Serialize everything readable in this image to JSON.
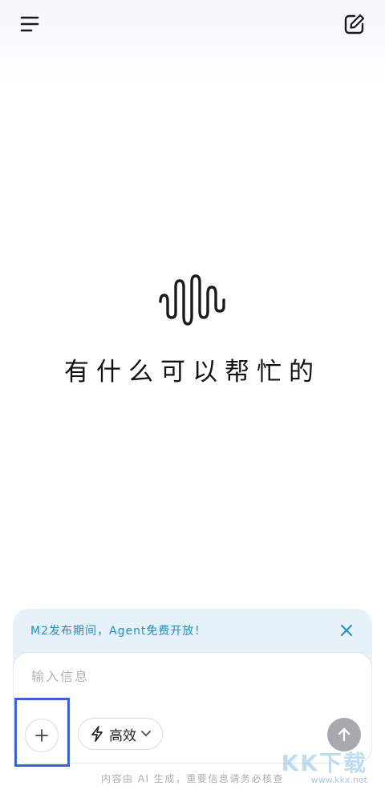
{
  "header": {
    "menu_icon": "menu-icon",
    "edit_icon": "compose-icon"
  },
  "hero": {
    "logo_icon": "soundwave-logo-icon",
    "title": "有什么可以帮忙的"
  },
  "banner": {
    "text": "M2发布期间，Agent免费开放！",
    "close_icon": "close-icon",
    "accent_color": "#1f8fc0"
  },
  "composer": {
    "placeholder": "输入信息",
    "plus_icon": "plus-icon",
    "mode": {
      "icon": "lightning-icon",
      "label": "高效",
      "chevron_icon": "chevron-down-icon"
    },
    "send_icon": "arrow-up-icon"
  },
  "footer": {
    "disclaimer": "内容由 AI 生成，重要信息请务必核查"
  },
  "watermark": {
    "logo": "KK下载",
    "url": "www.kkx.net"
  },
  "colors": {
    "highlight": "#3a60d8",
    "send_bg": "#a6a9ae",
    "banner_bg": "#e6f1fa"
  }
}
